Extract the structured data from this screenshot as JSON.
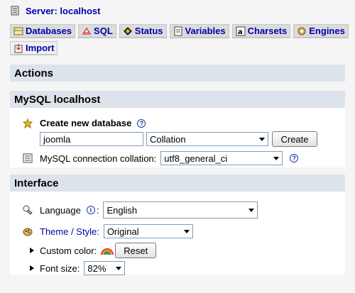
{
  "server": {
    "label": "Server: localhost",
    "icon": "server-icon"
  },
  "tabs": [
    {
      "label": "Databases",
      "icon": "databases-icon"
    },
    {
      "label": "SQL",
      "icon": "sql-icon"
    },
    {
      "label": "Status",
      "icon": "status-icon"
    },
    {
      "label": "Variables",
      "icon": "variables-icon"
    },
    {
      "label": "Charsets",
      "icon": "charsets-icon"
    },
    {
      "label": "Engines",
      "icon": "engines-icon"
    }
  ],
  "tabs_row2": [
    {
      "label": "Import",
      "icon": "import-icon"
    }
  ],
  "actions": {
    "title": "Actions"
  },
  "mysql": {
    "title": "MySQL localhost",
    "create_db": {
      "label": "Create new database",
      "name_value": "joomla",
      "collation_value": "Collation",
      "button": "Create"
    },
    "connection": {
      "label": "MySQL connection collation:",
      "value": "utf8_general_ci"
    }
  },
  "interface": {
    "title": "Interface",
    "language": {
      "label": "Language",
      "value": "English"
    },
    "theme": {
      "label": "Theme / Style:",
      "value": "Original"
    },
    "custom_color": {
      "label": "Custom color:",
      "button": "Reset"
    },
    "font_size": {
      "label": "Font size:",
      "value": "82%"
    }
  },
  "colors": {
    "link": "#0000aa",
    "panel_header": "#dde3ea",
    "background": "#f5f5f5"
  }
}
